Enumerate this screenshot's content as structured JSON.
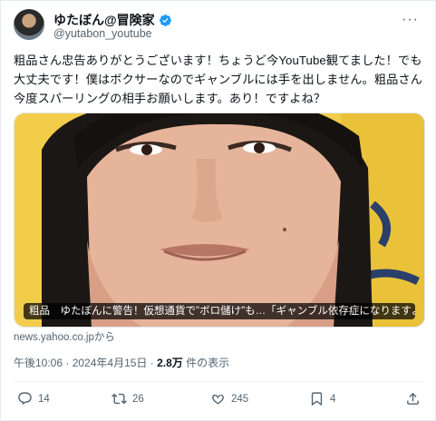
{
  "post": {
    "display_name": "ゆたぼん@冒険家",
    "handle": "@yutabon_youtube",
    "body": "粗品さん忠告ありがとうございます！ちょうど今YouTube観てました！でも大丈夫です！僕はボクサーなのでギャンブルには手を出しません。粗品さん今度スパーリングの相手お願いします。あり！ですよね？",
    "media_caption": "粗品　ゆたぼんに警告！仮想通貨で\"ボロ儲け\"も…「ギャンブル依存症になりますよ、こ…",
    "source": "news.yahoo.co.jpから",
    "timestamp": "午後10:06 · 2024年4月15日 · ",
    "views_count": "2.8万",
    "views_label": " 件の表示"
  },
  "actions": {
    "reply_count": "14",
    "repost_count": "26",
    "like_count": "245",
    "bookmark_count": "4"
  },
  "icons": {
    "verified": "verified-badge-icon",
    "more": "more-icon",
    "reply": "reply-icon",
    "repost": "repost-icon",
    "like": "heart-icon",
    "bookmark": "bookmark-icon",
    "share": "share-icon"
  },
  "colors": {
    "verified": "#1d9bf0",
    "muted": "#536471",
    "text": "#0f1419"
  }
}
